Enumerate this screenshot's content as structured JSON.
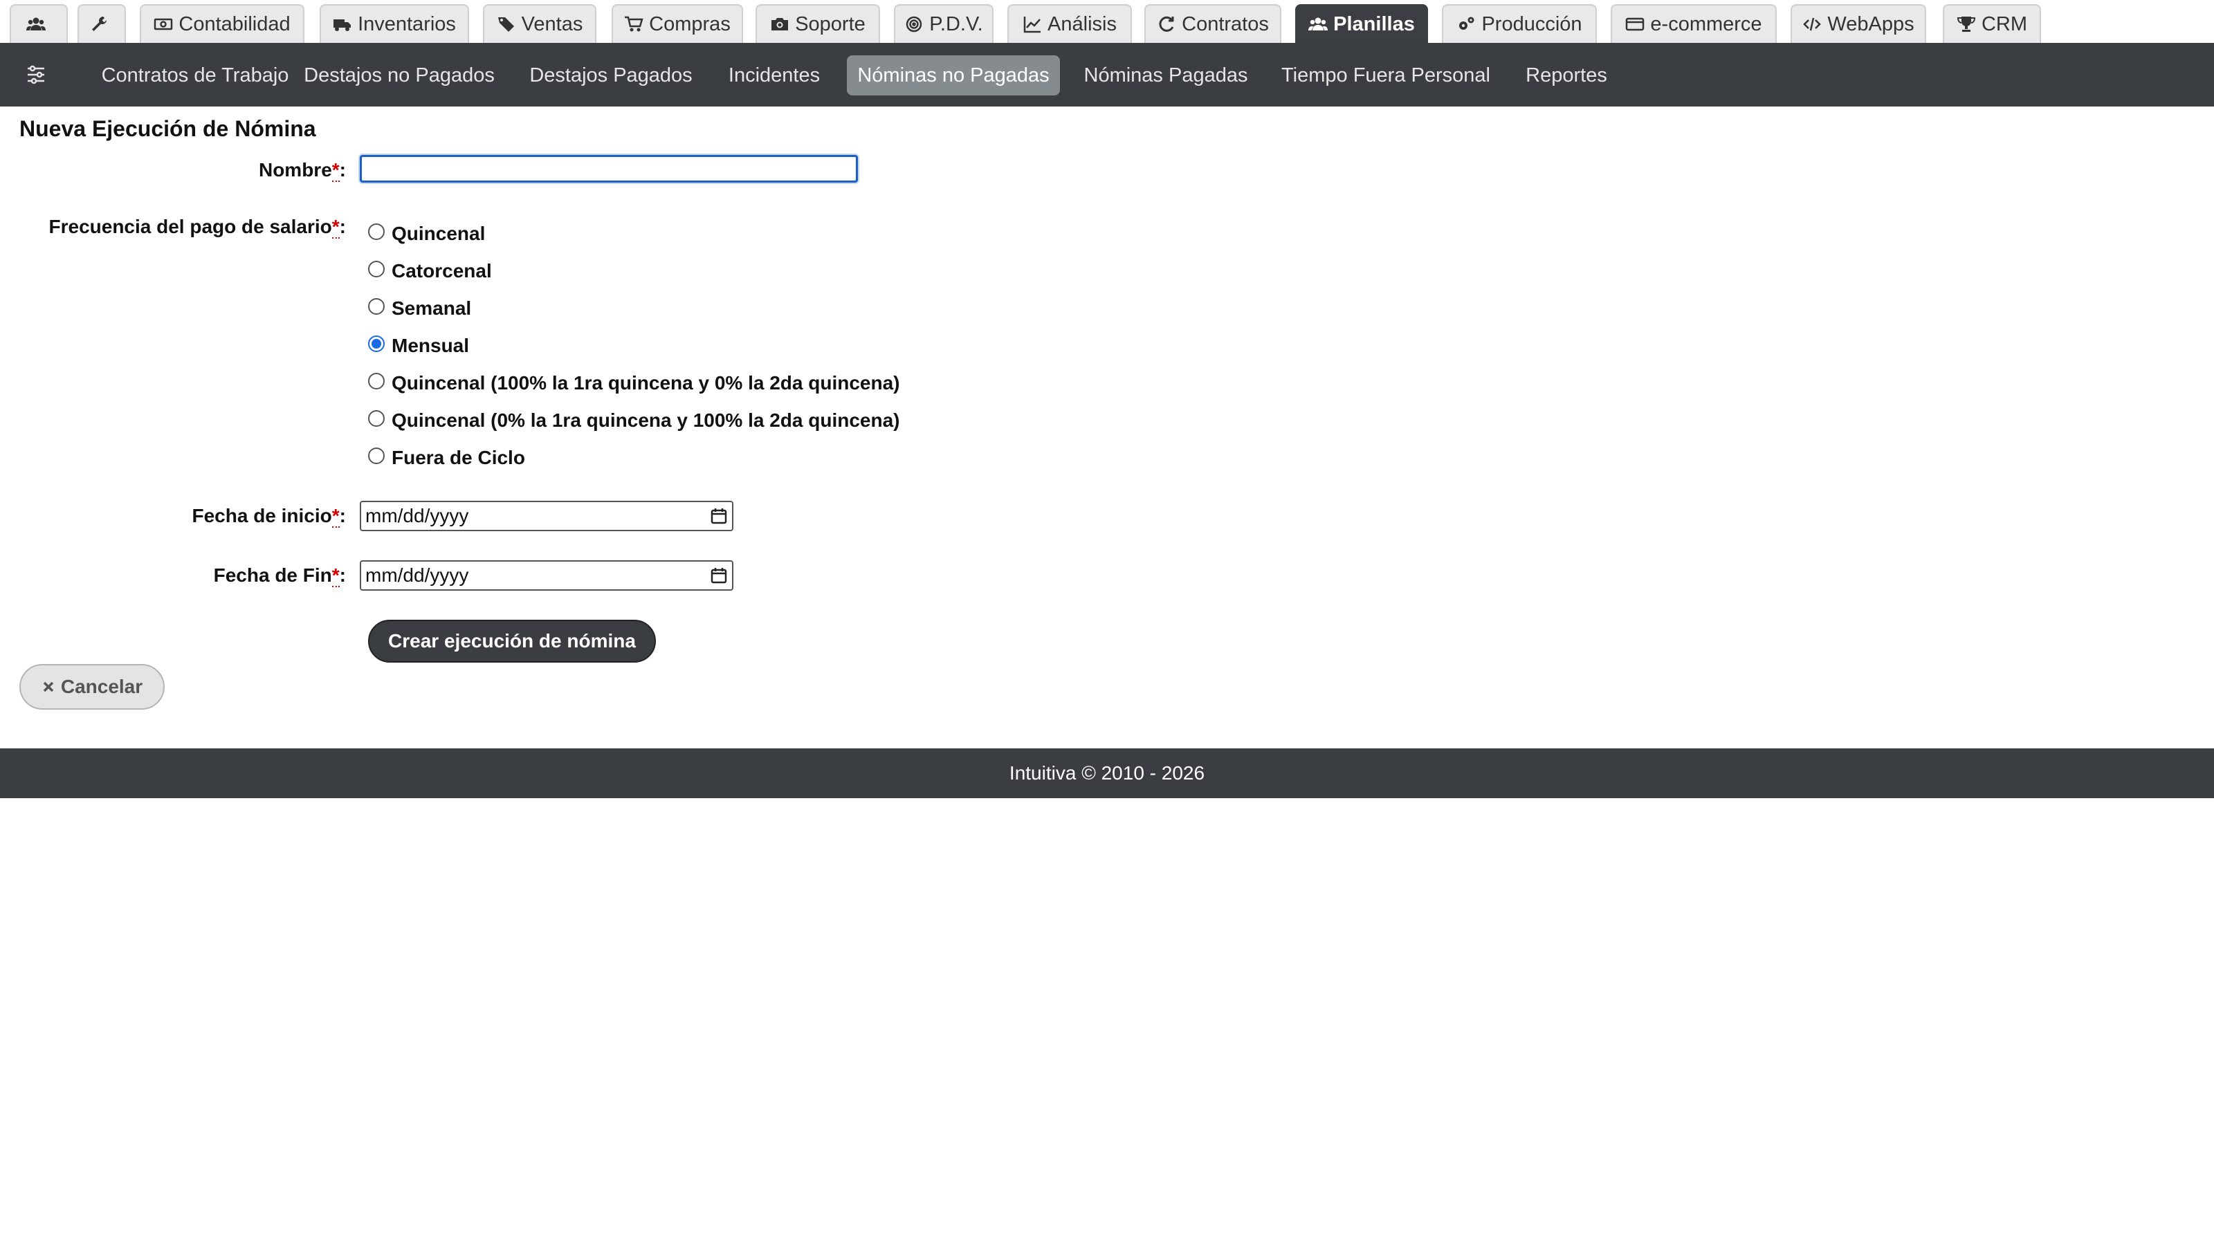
{
  "modules": {
    "tabs": [
      {
        "label": "",
        "icon": "users-icon"
      },
      {
        "label": "",
        "icon": "wrench-icon"
      },
      {
        "label": "Contabilidad",
        "icon": "money-icon"
      },
      {
        "label": "Inventarios",
        "icon": "truck-icon"
      },
      {
        "label": "Ventas",
        "icon": "tags-icon"
      },
      {
        "label": "Compras",
        "icon": "cart-icon"
      },
      {
        "label": "Soporte",
        "icon": "camera-icon"
      },
      {
        "label": "P.D.V.",
        "icon": "bullseye-icon"
      },
      {
        "label": "Análisis",
        "icon": "chart-line-icon"
      },
      {
        "label": "Contratos",
        "icon": "refresh-icon"
      },
      {
        "label": "Planillas",
        "icon": "users-icon",
        "active": true
      },
      {
        "label": "Producción",
        "icon": "gears-icon"
      },
      {
        "label": "e-commerce",
        "icon": "credit-card-icon"
      },
      {
        "label": "WebApps",
        "icon": "code-icon"
      },
      {
        "label": "CRM",
        "icon": "trophy-icon"
      }
    ]
  },
  "submenu": {
    "icon": "sliders-icon",
    "items": [
      {
        "label": "Contratos de Trabajo"
      },
      {
        "label": "Destajos no Pagados"
      },
      {
        "label": "Destajos Pagados"
      },
      {
        "label": "Incidentes"
      },
      {
        "label": "Nóminas no Pagadas",
        "active": true
      },
      {
        "label": "Nóminas Pagadas"
      },
      {
        "label": "Tiempo Fuera Personal"
      },
      {
        "label": "Reportes"
      }
    ]
  },
  "form": {
    "title": "Nueva Ejecución de Nómina",
    "required_mark": "*",
    "colon": ":",
    "name_label": "Nombre",
    "name_value": "",
    "frequency_label": "Frecuencia del pago de salario",
    "frequency_options": [
      {
        "label": "Quincenal",
        "checked": false
      },
      {
        "label": "Catorcenal",
        "checked": false
      },
      {
        "label": "Semanal",
        "checked": false
      },
      {
        "label": "Mensual",
        "checked": true
      },
      {
        "label": "Quincenal (100% la 1ra quincena y 0% la 2da quincena)",
        "checked": false
      },
      {
        "label": "Quincenal (0% la 1ra quincena y 100% la 2da quincena)",
        "checked": false
      },
      {
        "label": "Fuera de Ciclo",
        "checked": false
      }
    ],
    "start_date_label": "Fecha de inicio",
    "start_date_placeholder": "mm/dd/yyyy",
    "end_date_label": "Fecha de Fin",
    "end_date_placeholder": "mm/dd/yyyy",
    "submit_label": "Crear ejecución de nómina",
    "cancel_label": "Cancelar"
  },
  "footer": {
    "text": "Intuitiva © 2010 - 2026"
  },
  "colors": {
    "dark_bar": "#3a3e42",
    "active_subitem": "#868b90",
    "focus_blue": "#1b5fc5",
    "required_red": "#d00000"
  }
}
